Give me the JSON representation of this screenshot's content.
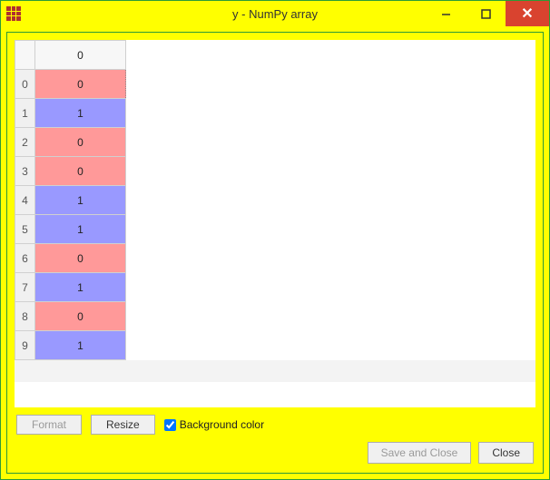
{
  "window": {
    "title": "y - NumPy array"
  },
  "colors": {
    "zero": "#ff9999",
    "one": "#9999ff"
  },
  "grid": {
    "column_header": "0",
    "rows": [
      {
        "index": "0",
        "value": "0",
        "selected": true
      },
      {
        "index": "1",
        "value": "1",
        "selected": false
      },
      {
        "index": "2",
        "value": "0",
        "selected": false
      },
      {
        "index": "3",
        "value": "0",
        "selected": false
      },
      {
        "index": "4",
        "value": "1",
        "selected": false
      },
      {
        "index": "5",
        "value": "1",
        "selected": false
      },
      {
        "index": "6",
        "value": "0",
        "selected": false
      },
      {
        "index": "7",
        "value": "1",
        "selected": false
      },
      {
        "index": "8",
        "value": "0",
        "selected": false
      },
      {
        "index": "9",
        "value": "1",
        "selected": false
      }
    ]
  },
  "toolbar": {
    "format_label": "Format",
    "resize_label": "Resize",
    "bgcolor_label": "Background color",
    "bgcolor_checked": true
  },
  "footer": {
    "save_label": "Save and Close",
    "close_label": "Close"
  },
  "chart_data": {
    "type": "table",
    "title": "y - NumPy array",
    "columns": [
      "0"
    ],
    "index": [
      0,
      1,
      2,
      3,
      4,
      5,
      6,
      7,
      8,
      9
    ],
    "values": [
      0,
      1,
      0,
      0,
      1,
      1,
      0,
      1,
      0,
      1
    ]
  }
}
